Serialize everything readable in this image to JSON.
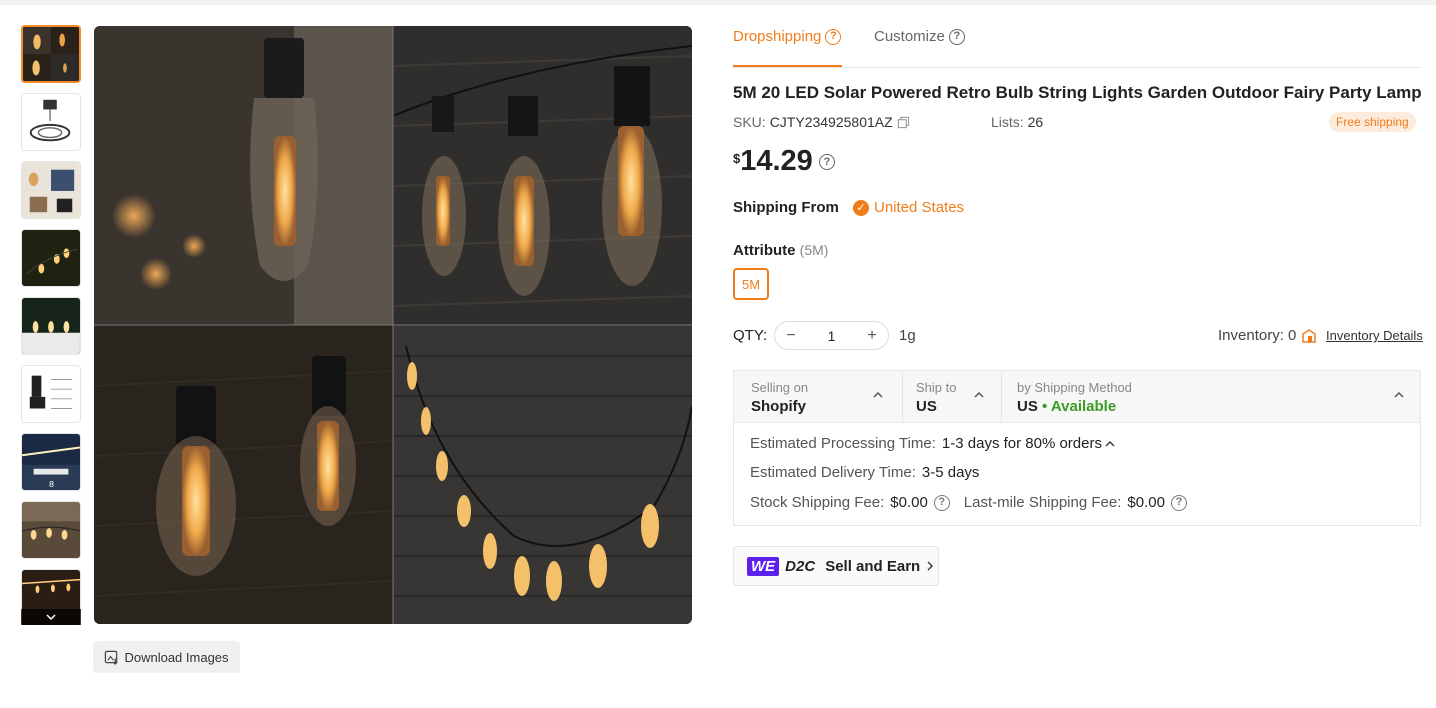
{
  "tabs": [
    {
      "label": "Dropshipping"
    },
    {
      "label": "Customize"
    }
  ],
  "product": {
    "title": "5M 20 LED Solar Powered Retro Bulb String Lights Garden Outdoor Fairy Party Lamp",
    "sku_label": "SKU:",
    "sku": "CJTY234925801AZ",
    "lists_label": "Lists:",
    "lists": "26",
    "free_shipping": "Free shipping",
    "currency": "$",
    "price": "14.29"
  },
  "shipping_from": {
    "label": "Shipping From",
    "value": "United States"
  },
  "attribute": {
    "label": "Attribute",
    "selected": "(5M)",
    "options": [
      "5M"
    ]
  },
  "quantity": {
    "label": "QTY:",
    "value": "1",
    "minus": "−",
    "plus": "+",
    "weight": "1g"
  },
  "inventory": {
    "label": "Inventory: 0",
    "details_link": "Inventory Details"
  },
  "shipping": {
    "selling_on_label": "Selling on",
    "selling_on": "Shopify",
    "ship_to_label": "Ship to",
    "ship_to": "US",
    "method_label": "by Shipping Method",
    "method_country": "US",
    "method_status": "• Available",
    "processing_label": "Estimated Processing Time:",
    "processing_value": "1-3 days for 80% orders",
    "delivery_label": "Estimated Delivery Time:",
    "delivery_value": "3-5 days",
    "stock_fee_label": "Stock Shipping Fee:",
    "stock_fee": "$0.00",
    "lastmile_label": "Last-mile Shipping Fee:",
    "lastmile_fee": "$0.00"
  },
  "promo": {
    "we": "WE",
    "d2c": "D2C",
    "label": "Sell and Earn"
  },
  "gallery": {
    "download_label": "Download Images",
    "thumb_badge": "8"
  },
  "colors": {
    "accent": "#f07d1a",
    "available": "#3a9d23",
    "we_brand": "#5b21e8"
  }
}
